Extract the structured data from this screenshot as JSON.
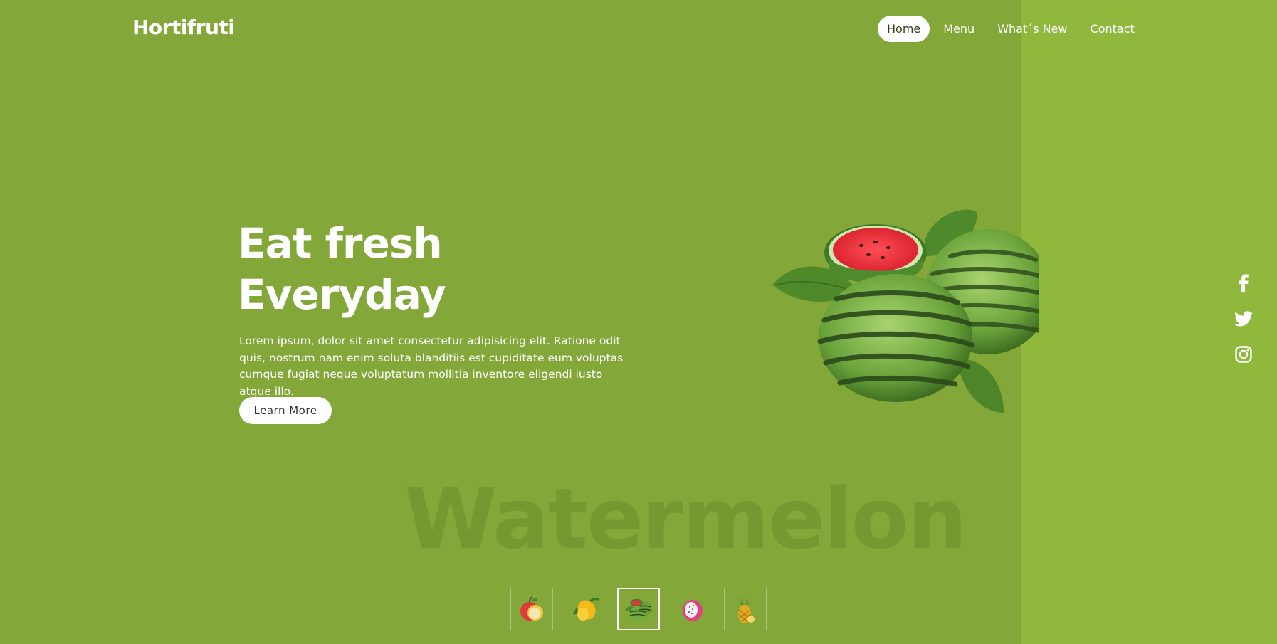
{
  "brand": {
    "name": "Hortifruti"
  },
  "nav": {
    "items": [
      {
        "label": "Home",
        "active": true
      },
      {
        "label": "Menu",
        "active": false
      },
      {
        "label": "What´s New",
        "active": false
      },
      {
        "label": "Contact",
        "active": false
      }
    ]
  },
  "hero": {
    "title_line1": "Eat fresh",
    "title_line2": "Everyday",
    "description": "Lorem ipsum, dolor sit amet consectetur adipisicing elit. Ratione odit quis, nostrum nam enim soluta blanditiis est cupiditate eum voluptas cumque fugiat neque voluptatum mollitia inventore eligendi iusto atque illo.",
    "button_label": "Learn More",
    "background_word": "Watermelon",
    "fruit_icon": "watermelon-image"
  },
  "social": [
    {
      "icon": "facebook-icon"
    },
    {
      "icon": "twitter-icon"
    },
    {
      "icon": "instagram-icon"
    }
  ],
  "thumbnails": [
    {
      "icon": "apple-icon",
      "active": false
    },
    {
      "icon": "mango-icon",
      "active": false
    },
    {
      "icon": "watermelon-icon",
      "active": true
    },
    {
      "icon": "dragonfruit-icon",
      "active": false
    },
    {
      "icon": "pineapple-icon",
      "active": false
    }
  ],
  "colors": {
    "main_bg": "#83a738",
    "side_bg": "#8fb83c",
    "text": "#ffffff"
  }
}
